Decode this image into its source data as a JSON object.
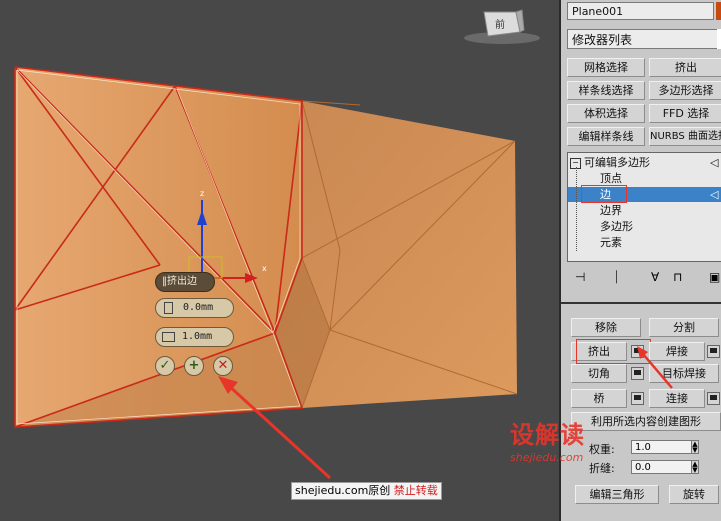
{
  "viewport": {
    "caddy_title": "挤出边",
    "height_value": "0.0mm",
    "width_value": "1.0mm",
    "gizmo_axes": {
      "x": "x",
      "z": "z"
    },
    "viewcube_label": "前",
    "watermark_site": "shejiedu.com",
    "watermark_original": "原创",
    "watermark_notice": "禁止转载",
    "brand_name": "设解读",
    "brand_url": "shejiedu.com"
  },
  "panel": {
    "object_name": "Plane001",
    "modifier_list": "修改器列表",
    "quick_buttons": [
      "网格选择",
      "挤出",
      "样条线选择",
      "多边形选择",
      "体积选择",
      "FFD 选择",
      "编辑样条线",
      "NURBS 曲面选择"
    ],
    "stack": {
      "root": "可编辑多边形",
      "items": [
        "顶点",
        "边",
        "边界",
        "多边形",
        "元素"
      ]
    },
    "edit_edges": {
      "remove": "移除",
      "split": "分割",
      "extrude": "挤出",
      "weld": "焊接",
      "chamfer": "切角",
      "target_weld": "目标焊接",
      "bridge": "桥",
      "connect": "连接",
      "create_shape": "利用所选内容创建图形",
      "weight_label": "权重:",
      "weight_value": "1.0",
      "crease_label": "折缝:",
      "crease_value": "0.0",
      "edit_tri": "编辑三角形",
      "turn": "旋转"
    }
  },
  "colors": {
    "mesh": "#d79a5e",
    "edge_highlight": "#c92a1a",
    "selection": "#3b82c9",
    "annotation_red": "#e8352a"
  }
}
